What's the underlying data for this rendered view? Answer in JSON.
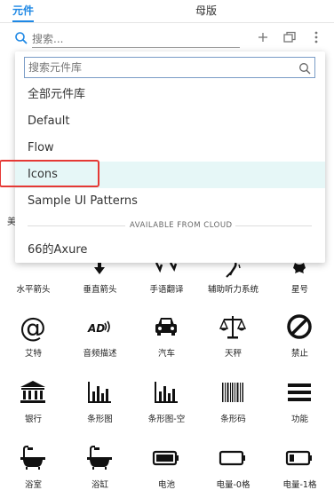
{
  "tabs": [
    {
      "label": "元件"
    },
    {
      "label": "母版"
    }
  ],
  "toolbar": {
    "search_placeholder": "搜索..."
  },
  "dropdown": {
    "search_placeholder": "搜索元件库",
    "items": [
      {
        "label": "全部元件库"
      },
      {
        "label": "Default"
      },
      {
        "label": "Flow"
      },
      {
        "label": "Icons"
      },
      {
        "label": "Sample UI Patterns"
      }
    ],
    "divider_label": "AVAILABLE FROM CLOUD",
    "cloud_items": [
      {
        "label": "66的Axure"
      }
    ]
  },
  "partial_left_label": "美",
  "icon_grid": [
    {
      "label": "水平箭头",
      "icon": "horizontal-arrow-icon"
    },
    {
      "label": "垂直箭头",
      "icon": "vertical-arrow-icon"
    },
    {
      "label": "手语翻译",
      "icon": "sign-language-icon"
    },
    {
      "label": "辅助听力系统",
      "icon": "assistive-listening-icon"
    },
    {
      "label": "星号",
      "icon": "asterisk-icon"
    },
    {
      "label": "艾特",
      "icon": "at-sign-icon"
    },
    {
      "label": "音频描述",
      "icon": "audio-description-icon"
    },
    {
      "label": "汽车",
      "icon": "car-icon"
    },
    {
      "label": "天秤",
      "icon": "balance-scale-icon"
    },
    {
      "label": "禁止",
      "icon": "ban-icon"
    },
    {
      "label": "银行",
      "icon": "bank-icon"
    },
    {
      "label": "条形图",
      "icon": "bar-chart-icon"
    },
    {
      "label": "条形图-空",
      "icon": "bar-chart-outline-icon"
    },
    {
      "label": "条形码",
      "icon": "barcode-icon"
    },
    {
      "label": "功能",
      "icon": "menu-bars-icon"
    },
    {
      "label": "浴室",
      "icon": "bathtub-icon"
    },
    {
      "label": "浴缸",
      "icon": "bath-icon"
    },
    {
      "label": "电池",
      "icon": "battery-full-icon"
    },
    {
      "label": "电量-0格",
      "icon": "battery-empty-icon"
    },
    {
      "label": "电量-1格",
      "icon": "battery-quarter-icon"
    }
  ]
}
